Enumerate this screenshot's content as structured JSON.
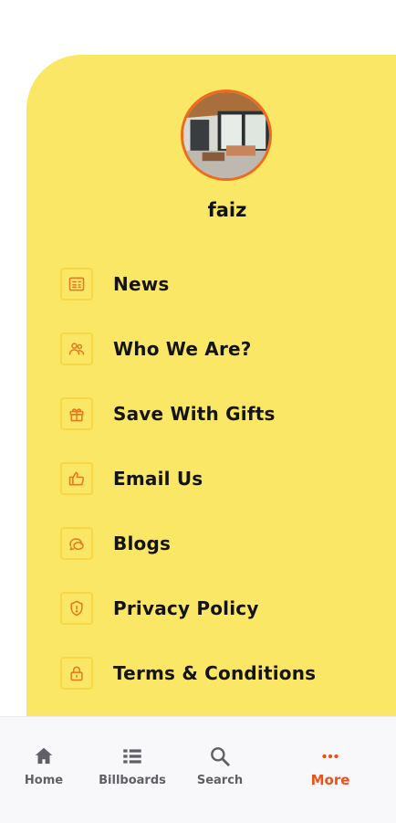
{
  "profile": {
    "username": "faiz"
  },
  "menu": {
    "items": [
      {
        "label": "News",
        "icon": "newspaper-icon"
      },
      {
        "label": "Who We Are?",
        "icon": "people-icon"
      },
      {
        "label": "Save With Gifts",
        "icon": "gift-icon"
      },
      {
        "label": "Email Us",
        "icon": "thumbs-up-icon"
      },
      {
        "label": "Blogs",
        "icon": "chat-bubbles-icon"
      },
      {
        "label": "Privacy Policy",
        "icon": "shield-icon"
      },
      {
        "label": "Terms & Conditions",
        "icon": "lock-icon"
      }
    ]
  },
  "bottom_nav": {
    "items": [
      {
        "label": "Home",
        "icon": "home-icon",
        "active": false
      },
      {
        "label": "Billboards",
        "icon": "list-icon",
        "active": false
      },
      {
        "label": "Search",
        "icon": "search-icon",
        "active": false
      },
      {
        "label": "More",
        "icon": "more-dots-icon",
        "active": true
      }
    ]
  },
  "colors": {
    "panel": "#fbe766",
    "accent": "#e9521a",
    "icon_stroke": "#e8761f",
    "nav_inactive": "#5f6065"
  }
}
